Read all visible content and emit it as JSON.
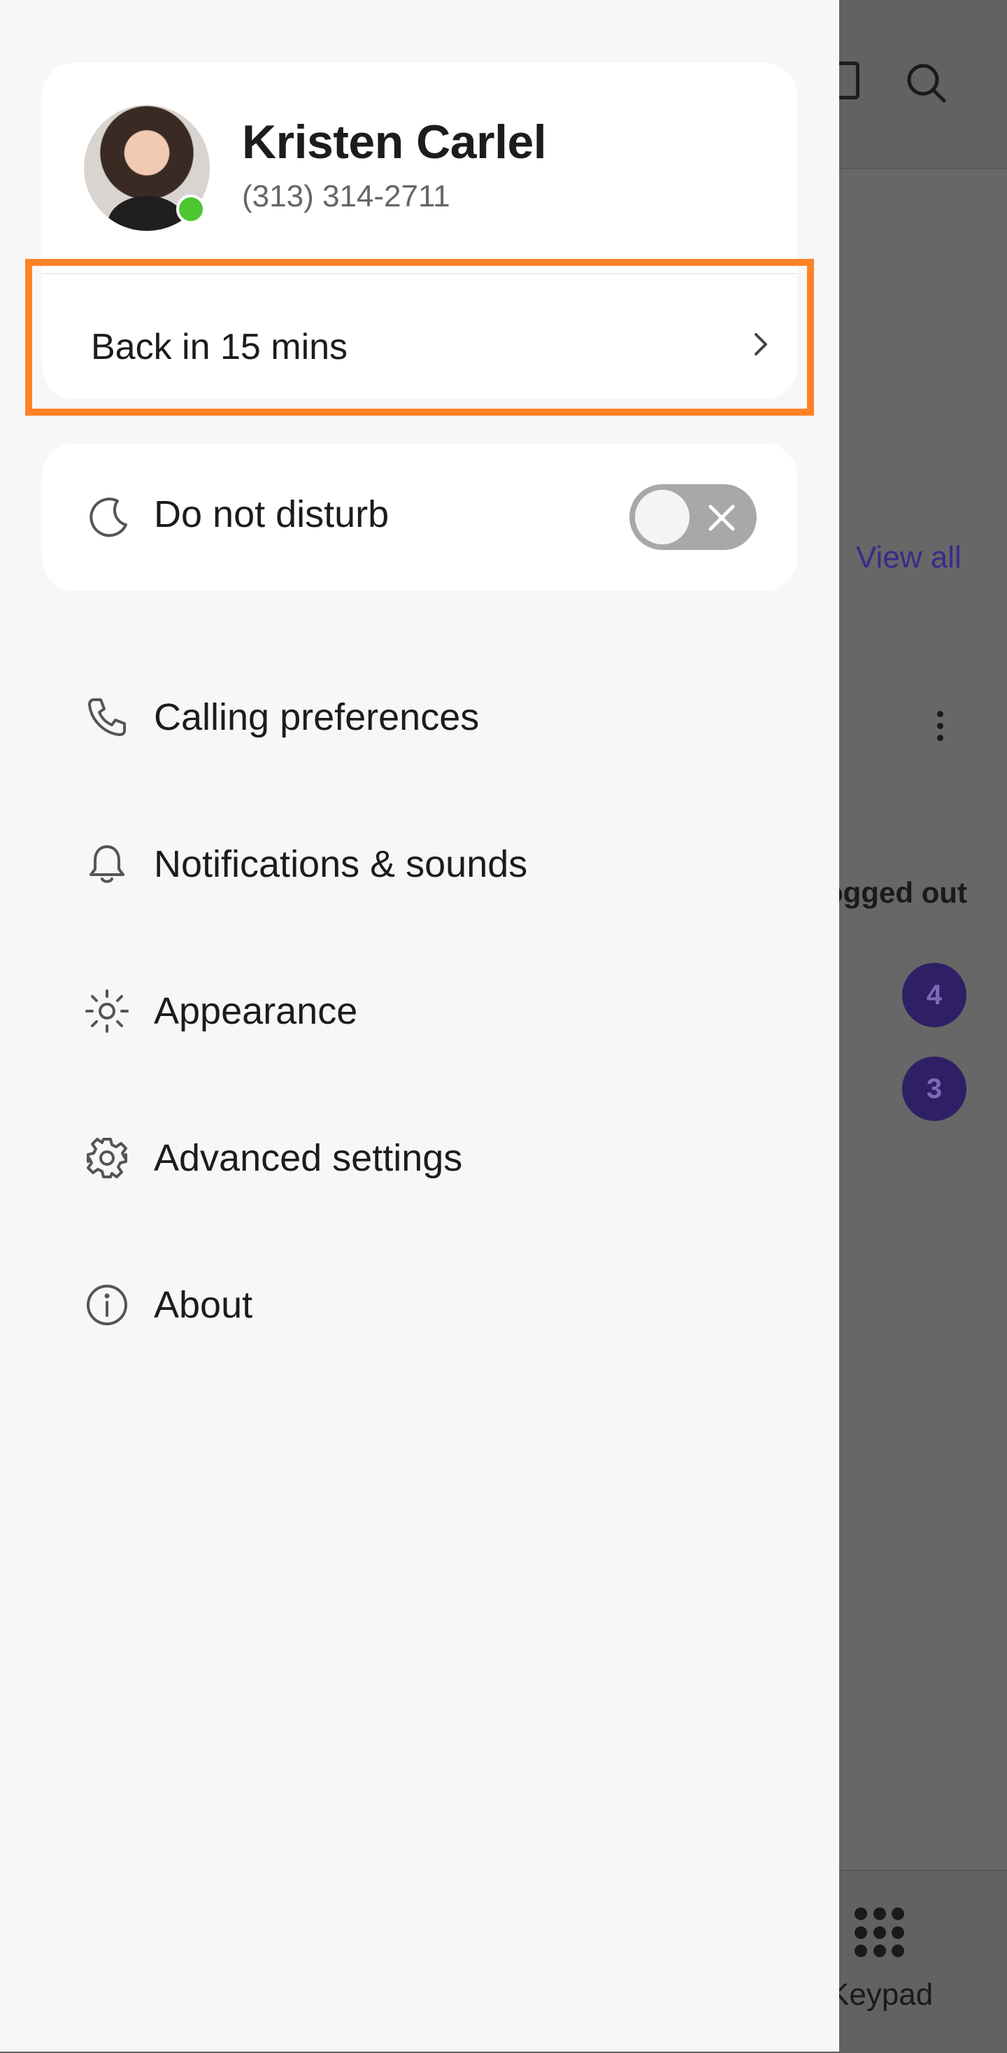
{
  "background": {
    "view_all_label": "View all",
    "logged_out_label": "ogged out",
    "badges": [
      "4",
      "3"
    ],
    "keypad_label": "Keypad"
  },
  "profile": {
    "name": "Kristen Carlel",
    "phone": "(313) 314-2711",
    "presence_color": "#4cc631"
  },
  "status": {
    "label": "Back in 15 mins",
    "highlight_color": "#ff8227"
  },
  "dnd": {
    "label": "Do not disturb",
    "enabled": false
  },
  "menu": [
    {
      "label": "Calling preferences",
      "icon": "phone-icon"
    },
    {
      "label": "Notifications & sounds",
      "icon": "bell-icon"
    },
    {
      "label": "Appearance",
      "icon": "sun-icon"
    },
    {
      "label": "Advanced settings",
      "icon": "gear-icon"
    },
    {
      "label": "About",
      "icon": "info-icon"
    }
  ]
}
